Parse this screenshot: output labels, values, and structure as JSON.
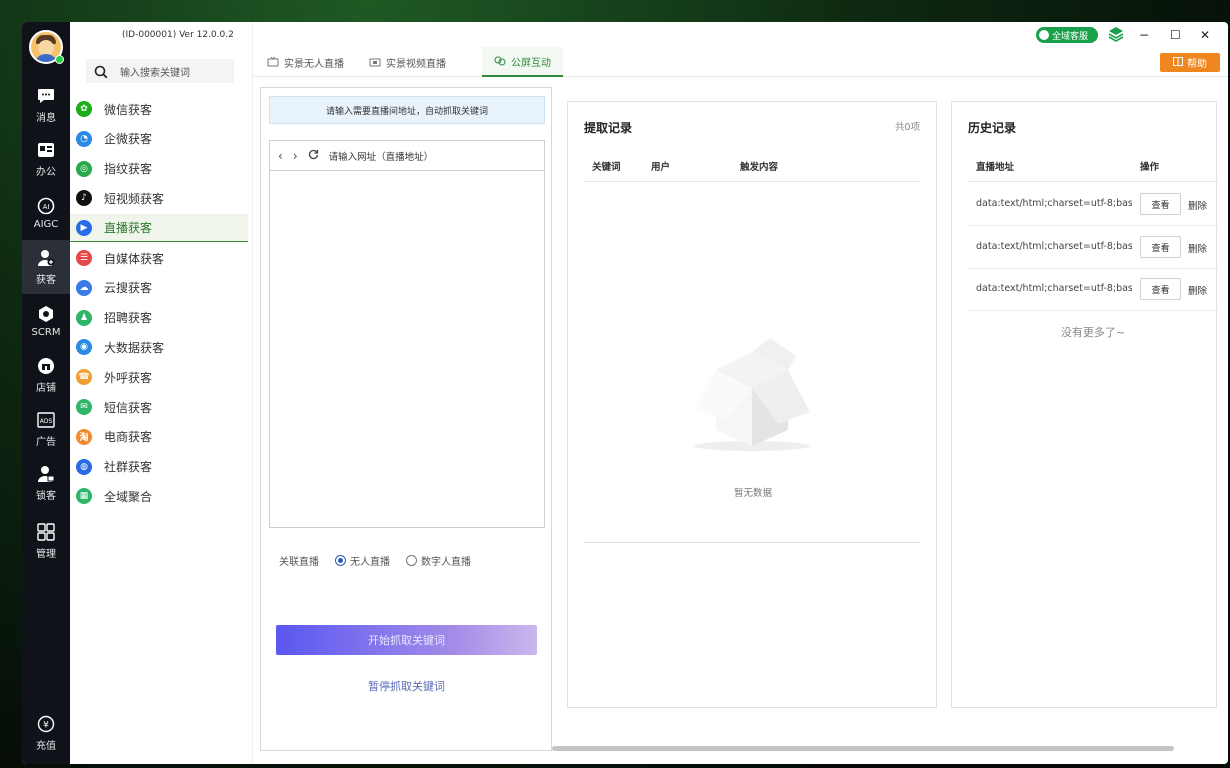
{
  "app": {
    "id_version": "(ID-000001)  Ver 12.0.0.2",
    "support_label": "全域客服",
    "help_label": "帮助",
    "window_controls": {
      "minimize": "−",
      "maximize": "☐",
      "close": "✕"
    }
  },
  "rail": {
    "items": [
      {
        "label": "消息",
        "icon": "message-icon"
      },
      {
        "label": "办公",
        "icon": "office-icon"
      },
      {
        "label": "AIGC",
        "icon": "ai-icon"
      },
      {
        "label": "获客",
        "icon": "user-add-icon"
      },
      {
        "label": "SCRM",
        "icon": "scrm-icon"
      },
      {
        "label": "店铺",
        "icon": "store-icon"
      },
      {
        "label": "广告",
        "icon": "ads-icon"
      },
      {
        "label": "锁客",
        "icon": "user-lock-icon"
      },
      {
        "label": "管理",
        "icon": "grid-icon"
      }
    ],
    "recharge_label": "充值"
  },
  "search": {
    "placeholder": "输入搜索关键词"
  },
  "nav": {
    "items": [
      {
        "label": "微信获客",
        "color": "#1aad19"
      },
      {
        "label": "企微获客",
        "color": "#2a8ae5"
      },
      {
        "label": "指纹获客",
        "color": "#2aa84a"
      },
      {
        "label": "短视频获客",
        "color": "#111111"
      },
      {
        "label": "直播获客",
        "color": "#2a6ae5"
      },
      {
        "label": "自媒体获客",
        "color": "#e54848"
      },
      {
        "label": "云搜获客",
        "color": "#3a7be5"
      },
      {
        "label": "招聘获客",
        "color": "#2fb56a"
      },
      {
        "label": "大数据获客",
        "color": "#2a8ae5"
      },
      {
        "label": "外呼获客",
        "color": "#f0a030"
      },
      {
        "label": "短信获客",
        "color": "#2fb56a"
      },
      {
        "label": "电商获客",
        "color": "#f08a30"
      },
      {
        "label": "社群获客",
        "color": "#2a6ae5"
      },
      {
        "label": "全域聚合",
        "color": "#2fb56a"
      }
    ]
  },
  "tabs": [
    {
      "label": "实景无人直播"
    },
    {
      "label": "实景视频直播"
    },
    {
      "label": "公屏互动"
    }
  ],
  "capture": {
    "hint": "请输入需要直播间地址，自动抓取关键词",
    "url_placeholder": "请输入网址（直播地址）",
    "radio_label": "关联直播",
    "radio_options": [
      "无人直播",
      "数字人直播"
    ],
    "start_label": "开始抓取关键词",
    "stop_label": "暂停抓取关键词"
  },
  "records": {
    "title": "提取记录",
    "count": "共0项",
    "columns": [
      "关键词",
      "用户",
      "触发内容"
    ],
    "empty": "暂无数据"
  },
  "history": {
    "title": "历史记录",
    "columns": [
      "直播地址",
      "操作"
    ],
    "rows": [
      {
        "url": "data:text/html;charset=utf-8;base64",
        "view": "查看",
        "delete": "删除"
      },
      {
        "url": "data:text/html;charset=utf-8;base64",
        "view": "查看",
        "delete": "删除"
      },
      {
        "url": "data:text/html;charset=utf-8;base64",
        "view": "查看",
        "delete": "删除"
      }
    ],
    "no_more": "没有更多了~"
  }
}
